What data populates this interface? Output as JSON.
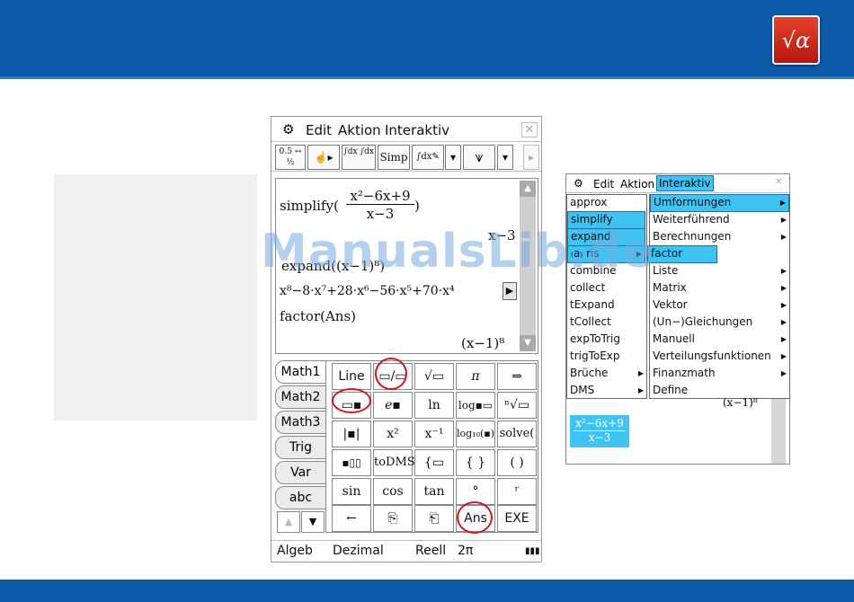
{
  "logo": {
    "symbol": "√α"
  },
  "calculator": {
    "menu": {
      "edit": "Edit",
      "aktion": "Aktion",
      "interaktiv": "Interaktiv",
      "close": "✕"
    },
    "toolbar": {
      "frac": "0.5 ↔ ½",
      "hand": "☝▸",
      "integrals": "∫dx ∫dx",
      "simp": "Simp",
      "intpen": "∫dx✎",
      "down1": "▾",
      "graph": "⩛",
      "down2": "▾",
      "right": "▸"
    },
    "work": {
      "line1_cmd": "simplify(",
      "line1_num": "x²−6x+9",
      "line1_den": "x−3",
      "line1_close": ")",
      "line2_result": "x−3",
      "line3": "expand((x−1)⁸)",
      "line4": "x⁸−8·x⁷+28·x⁶−56·x⁵+70·x⁴",
      "line4_more": "▶",
      "line5": "factor(Ans)",
      "line6": "(x−1)⁸"
    },
    "tabs": [
      "Math1",
      "Math2",
      "Math3",
      "Trig",
      "Var",
      "abc"
    ],
    "tab_nav": {
      "up": "▲",
      "down": "▼"
    },
    "keys": {
      "row1": [
        "Line",
        "▭/▭",
        "√▭",
        "π",
        "⇒"
      ],
      "row2": [
        "▭▪",
        "e▪",
        "ln",
        "log▪▭",
        "ⁿ√▭"
      ],
      "row3": [
        "|▪|",
        "x²",
        "x⁻¹",
        "log₁₀(▪)",
        "solve("
      ],
      "row4": [
        "▪▯▯",
        "toDMS",
        "{▭",
        "{ }",
        "( )"
      ],
      "row5": [
        "sin",
        "cos",
        "tan",
        "°",
        "ʳ"
      ],
      "row6": [
        "←",
        "⎘",
        "⎗",
        "Ans",
        "EXE"
      ]
    },
    "status": {
      "mode1": "Algeb",
      "mode2": "Dezimal",
      "mode3": "Reell",
      "mode4": "2π",
      "battery": "▮▮▮"
    }
  },
  "mini": {
    "menu": {
      "edit": "Edit",
      "aktion": "Aktion",
      "interaktiv": "Interaktiv",
      "close": "✕"
    },
    "left_items": [
      "approx",
      "simplify",
      "expand",
      "Ableitung",
      "combine",
      "collect",
      "tExpand",
      "tCollect",
      "expToTrig",
      "trigToExp",
      "Brüche",
      "DMS"
    ],
    "left_visible": [
      "approx",
      "simplify",
      "expand",
      "₍a₎ ris",
      "combine",
      "collect",
      "tExpand",
      "tCollect",
      "expToTrig",
      "trigToExp",
      "Brüche",
      "DMS"
    ],
    "right_items": [
      "Umformungen",
      "Weiterführend",
      "Berechnungen",
      "factor",
      "Liste",
      "Matrix",
      "Vektor",
      "(Un−)Gleichungen",
      "Manuell",
      "Verteilungsfunktionen",
      "Finanzmath",
      "Define"
    ],
    "behind_result": "(x−1)⁸",
    "frac_num": "x²−6x+9",
    "frac_den": "x−3"
  },
  "watermark": "ManualsLib.de"
}
